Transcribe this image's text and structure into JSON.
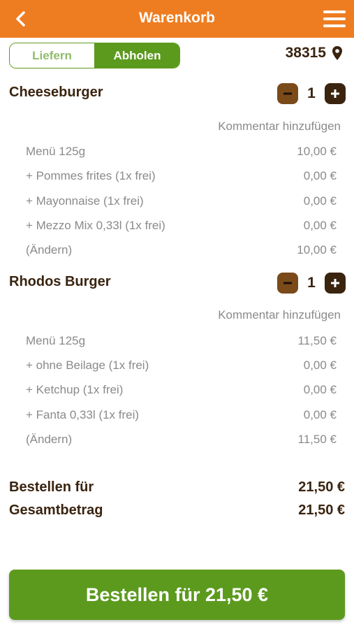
{
  "header": {
    "title": "Warenkorb"
  },
  "mode": {
    "deliver_label": "Liefern",
    "pickup_label": "Abholen",
    "selected": "Abholen"
  },
  "location": {
    "zip": "38315"
  },
  "items": [
    {
      "name": "Cheeseburger",
      "quantity": "1",
      "comment_label": "Kommentar hinzufügen",
      "lines": [
        {
          "label": "Menü 125g",
          "price": "10,00 €"
        },
        {
          "label": "+ Pommes frites (1x frei)",
          "price": "0,00 €"
        },
        {
          "label": "+ Mayonnaise (1x frei)",
          "price": "0,00 €"
        },
        {
          "label": "+ Mezzo Mix 0,33l (1x frei)",
          "price": "0,00 €"
        },
        {
          "label": "(Ändern)",
          "price": "10,00 €"
        }
      ]
    },
    {
      "name": "Rhodos Burger",
      "quantity": "1",
      "comment_label": "Kommentar hinzufügen",
      "lines": [
        {
          "label": "Menü 125g",
          "price": "11,50 €"
        },
        {
          "label": "+ ohne Beilage (1x frei)",
          "price": "0,00 €"
        },
        {
          "label": "+ Ketchup (1x frei)",
          "price": "0,00 €"
        },
        {
          "label": "+ Fanta 0,33l (1x frei)",
          "price": "0,00 €"
        },
        {
          "label": "(Ändern)",
          "price": "11,50 €"
        }
      ]
    }
  ],
  "summary": {
    "order_for_label": "Bestellen für",
    "order_for_value": "21,50 €",
    "total_label": "Gesamtbetrag",
    "total_value": "21,50 €"
  },
  "order_button": {
    "label": "Bestellen für 21,50 €"
  },
  "colors": {
    "header": "#ee7d22",
    "green": "#5c9a1e",
    "brown": "#3a2410"
  },
  "icons": {
    "back": "chevron-left-icon",
    "menu": "hamburger-menu-icon",
    "location": "map-pin-icon",
    "minus": "minus-icon",
    "plus": "plus-icon"
  }
}
